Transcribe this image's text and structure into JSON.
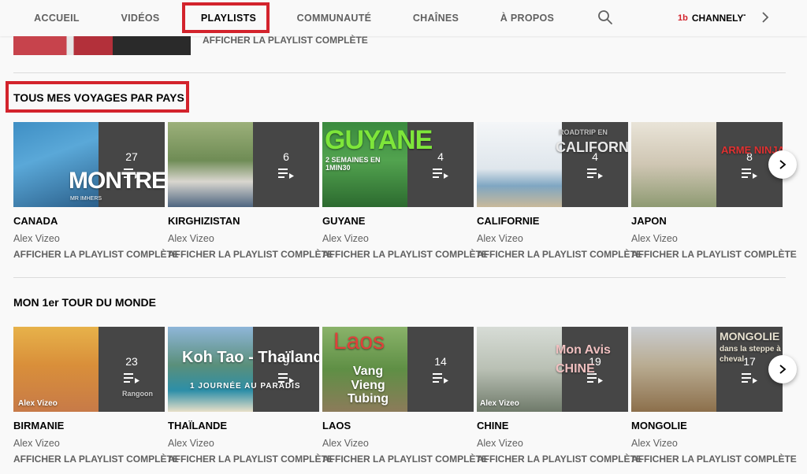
{
  "nav": {
    "tabs": [
      {
        "label": "ACCUEIL",
        "active": false
      },
      {
        "label": "VIDÉOS",
        "active": false
      },
      {
        "label": "PLAYLISTS",
        "active": true
      },
      {
        "label": "COMMUNAUTÉ",
        "active": false
      },
      {
        "label": "CHAÎNES",
        "active": false
      },
      {
        "label": "À PROPOS",
        "active": false
      }
    ],
    "search_icon": "search-icon",
    "brand_logo": "1b",
    "brand_name": "CHANNELYT",
    "next_icon": "chevron-right-icon"
  },
  "previous_section": {
    "link": "AFFICHER LA PLAYLIST COMPLÈTE"
  },
  "sections": [
    {
      "title": "TOUS MES VOYAGES PAR PAYS",
      "highlighted": true,
      "playlists": [
        {
          "title": "CANADA",
          "author": "Alex Vizeo",
          "count": "27",
          "link": "AFFICHER LA PLAYLIST COMPLÈTE",
          "thumb_text": "MONTREAL",
          "thumb_sub": "MR IMHERS"
        },
        {
          "title": "KIRGHIZISTAN",
          "author": "Alex Vizeo",
          "count": "6",
          "link": "AFFICHER LA PLAYLIST COMPLÈTE",
          "thumb_text": "",
          "thumb_sub": ""
        },
        {
          "title": "GUYANE",
          "author": "Alex Vizeo",
          "count": "4",
          "link": "AFFICHER LA PLAYLIST COMPLÈTE",
          "thumb_text": "GUYANE",
          "thumb_sub": "2 SEMAINES EN 1MIN30"
        },
        {
          "title": "CALIFORNIE",
          "author": "Alex Vizeo",
          "count": "4",
          "link": "AFFICHER LA PLAYLIST COMPLÈTE",
          "thumb_text": "CALIFORNIE",
          "thumb_sub": "ROADTRIP EN"
        },
        {
          "title": "JAPON",
          "author": "Alex Vizeo",
          "count": "8",
          "link": "AFFICHER LA PLAYLIST COMPLÈTE",
          "thumb_text": "ARME NINJA",
          "thumb_sub": ""
        }
      ]
    },
    {
      "title": "MON 1er TOUR DU MONDE",
      "highlighted": false,
      "playlists": [
        {
          "title": "BIRMANIE",
          "author": "Alex Vizeo",
          "count": "23",
          "link": "AFFICHER LA PLAYLIST COMPLÈTE",
          "thumb_text": "Alex Vizeo",
          "thumb_sub": "Rangoon"
        },
        {
          "title": "THAÏLANDE",
          "author": "Alex Vizeo",
          "count": "9",
          "link": "AFFICHER LA PLAYLIST COMPLÈTE",
          "thumb_text": "Koh Tao - Thaïlande",
          "thumb_sub": "1 JOURNÉE AU PARADIS"
        },
        {
          "title": "LAOS",
          "author": "Alex Vizeo",
          "count": "14",
          "link": "AFFICHER LA PLAYLIST COMPLÈTE",
          "thumb_text": "Laos",
          "thumb_sub": "Vang Vieng Tubing"
        },
        {
          "title": "CHINE",
          "author": "Alex Vizeo",
          "count": "19",
          "link": "AFFICHER LA PLAYLIST COMPLÈTE",
          "thumb_text": "Mon Avis CHINE",
          "thumb_sub": "Alex Vizeo"
        },
        {
          "title": "MONGOLIE",
          "author": "Alex Vizeo",
          "count": "17",
          "link": "AFFICHER LA PLAYLIST COMPLÈTE",
          "thumb_text": "MONGOLIE",
          "thumb_sub": "dans la steppe à cheval"
        }
      ]
    }
  ],
  "colors": {
    "highlight_red": "#d3232c",
    "text_primary": "#030303",
    "text_secondary": "#606060",
    "background": "#f9f9f9"
  }
}
